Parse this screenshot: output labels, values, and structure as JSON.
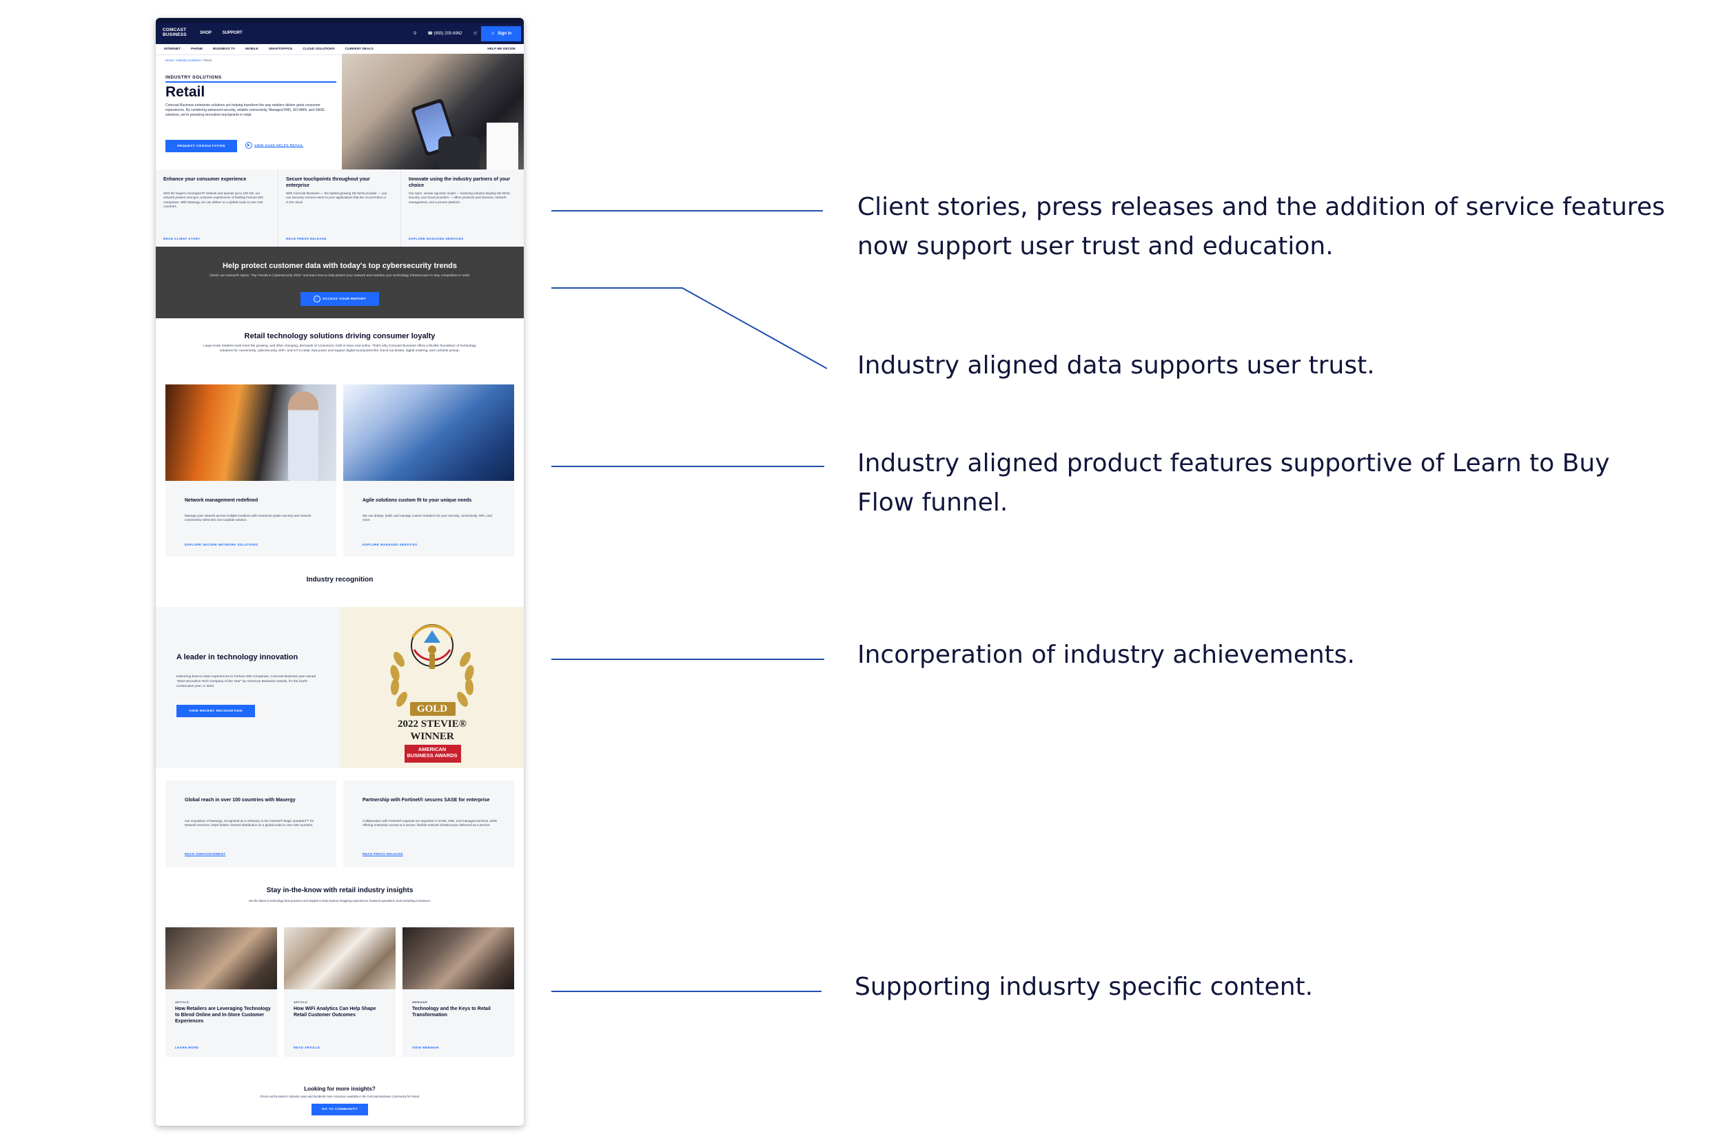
{
  "header": {
    "logo_line1": "COMCAST",
    "logo_line2": "BUSINESS",
    "nav": [
      "SHOP",
      "SUPPORT"
    ],
    "phone": "(855) 205-6962",
    "sign_in": "Sign in"
  },
  "subnav": {
    "items": [
      "INTERNET",
      "PHONE",
      "BUSINESS TV",
      "MOBILE",
      "SMARTOFFICE",
      "CLOUD SOLUTIONS",
      "CURRENT DEALS"
    ],
    "right": "HELP ME DECIDE"
  },
  "breadcrumb": {
    "home": "Home",
    "sep1": "/",
    "section": "Industry Solutions",
    "sep2": "/",
    "current": "Retail"
  },
  "hero": {
    "eyebrow": "INDUSTRY SOLUTIONS",
    "title": "Retail",
    "description": "Comcast Business enterprise solutions are helping transform the way retailers deliver great consumer experiences. By combining advanced security, reliable connectivity, Managed WiFi, SD-WAN, and SASE solutions, we're powering innovative touchpoints in retail.",
    "cta_primary": "REQUEST CONSULTATION",
    "cta_secondary": "VIEW SASE HELPS RETAIL"
  },
  "features": [
    {
      "title": "Enhance your consumer experience",
      "body": "With the largest converged IP network and speeds up to 100 GB, our network powers next-gen customer experiences of leading Fortune 500 companies. With Masergy, we can deliver on a global scale in over 100 countries.",
      "link": "READ CLIENT STORY"
    },
    {
      "title": "Secure touchpoints throughout your enterprise",
      "body": "With Comcast Business — the fastest growing SD-WAN provider — you can securely connect users to your applications that live on premises or in the cloud.",
      "link": "READ PRESS RELEASE"
    },
    {
      "title": "Innovate using the industry partners of your choice",
      "body": "Our open, vendor agnostic model — featuring industry-leading SD-WAN, security, and cloud providers — offers products and services, network management, and a proven platform.",
      "link": "EXPLORE MANAGED SERVICES"
    }
  ],
  "cyber_band": {
    "title": "Help protect customer data with today's top cybersecurity trends",
    "body": "Check out Gartner® report, \"Top Trends in Cybersecurity 2022\" and learn how to help protect your network and redefine your technology infrastructure to stay competitive in retail.",
    "cta": "ACCESS YOUR REPORT"
  },
  "solutions": {
    "title": "Retail technology solutions driving consumer loyalty",
    "body": "Large-scale retailers must meet the growing, and often changing, demands of consumers, both in-store and online. That's why Comcast Business offers a flexible foundation of technology solutions for connectivity, cybersecurity, WiFi, and IoT in retail, that power and support digital touchpoints like check-out kiosks, digital ordering, and curbside pickup.",
    "cards": [
      {
        "title": "Network management redefined",
        "body": "Manage your network across multiple locations with enterprise-grade security and network connectivity rolled into one scalable solution.",
        "link": "EXPLORE SECURE NETWORK SOLUTIONS"
      },
      {
        "title": "Agile solutions custom fit to your unique needs",
        "body": "We can design, build, and manage custom solutions for your security, connectivity, WiFi, and more.",
        "link": "EXPLORE MANAGED SERVICES"
      }
    ]
  },
  "recognition": {
    "title": "Industry recognition",
    "leader_title": "A leader in technology innovation",
    "leader_body": "Delivering best-in-class experiences to Fortune 500 companies, Comcast Business was named \"Most Innovative Tech Company of the Year\" by American Business Awards, for the fourth consecutive year, in 2022.",
    "leader_cta": "VIEW RECENT RECOGNITION",
    "award": {
      "gold": "GOLD",
      "stevie": "2022 STEVIE®",
      "winner": "WINNER",
      "org_line1": "AMERICAN",
      "org_line2": "BUSINESS AWARDS"
    },
    "cards": [
      {
        "title": "Global reach in over 100 countries with Masergy",
        "body": "Our acquisition of Masergy, recognized as a Visionary in the Gartner® Magic Quadrant™ for Network Services, helps bolster channel distribution on a global scale to over 100 countries.",
        "link": "READ ANNOUNCEMENT"
      },
      {
        "title": "Partnership with Fortinet® secures SASE for enterprise",
        "body": "Collaboration with Fortinet® expands our expertise in SASE, SSE, and managed services, while offering enterprise access to a secure, flexible network infrastructure delivered as a service.",
        "link": "READ PRESS RELEASE"
      }
    ]
  },
  "insights": {
    "title": "Stay in-the-know with retail industry insights",
    "body": "Get the latest in technology best practices and insights to help improve shopping experiences, backend operations, and everything in between.",
    "cards": [
      {
        "tag": "ARTICLE",
        "title": "How Retailers are Leveraging Technology to Blend Online and In-Store Customer Experiences",
        "link": "LEARN MORE"
      },
      {
        "tag": "ARTICLE",
        "title": "How WiFi Analytics Can Help Shape Retail Customer Outcomes",
        "link": "READ ARTICLE"
      },
      {
        "tag": "WEBINAR",
        "title": "Technology and the Keys to Retail Transformation",
        "link": "VIEW WEBINAR"
      }
    ],
    "more_title": "Looking for more insights?",
    "more_body": "Check out the latest in industry news and hundreds more resources available in the Comcast Business Community for Retail.",
    "more_cta": "GO TO COMMUNITY"
  },
  "annotations": [
    {
      "line1": "Client stories, press releases and the addition of service features",
      "line2": "now support user trust and education."
    },
    {
      "line1": "Industry aligned data supports user trust.",
      "line2": ""
    },
    {
      "line1": "Industry aligned product features supportive of Learn to Buy",
      "line2": "Flow funnel."
    },
    {
      "line1": "Incorperation of industry achievements.",
      "line2": ""
    },
    {
      "line1": "Supporting indusrty specific content.",
      "line2": ""
    }
  ],
  "colors": {
    "accent": "#1f69ff",
    "header": "#0f1a4b",
    "band": "#404040",
    "annotation_line": "#1f4fae"
  }
}
